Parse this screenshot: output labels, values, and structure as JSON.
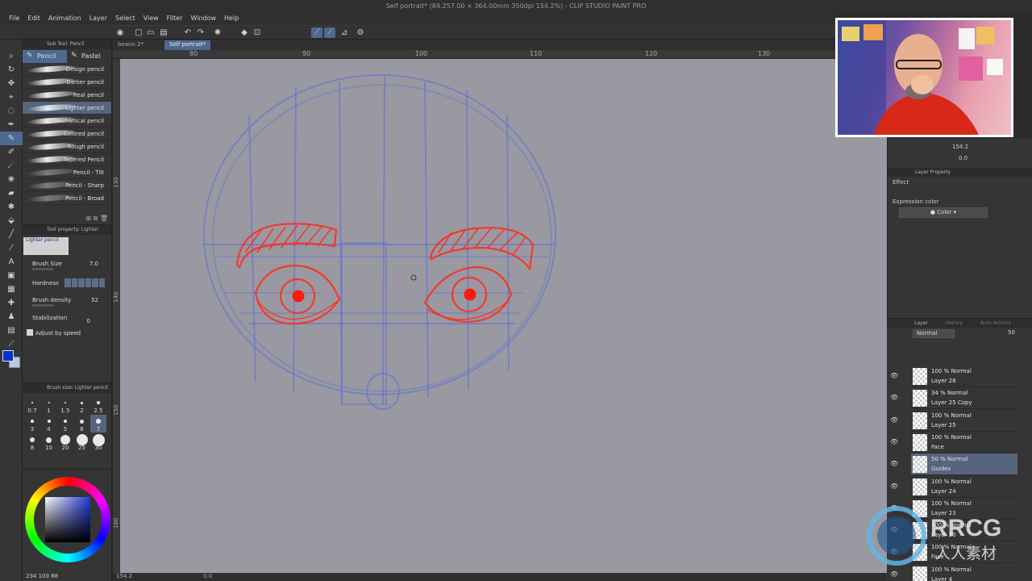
{
  "window": {
    "title": "Self portrait* (84.257.00 × 364.00mm 350dpi 154.2%) - CLIP STUDIO PAINT PRO"
  },
  "menu": [
    "File",
    "Edit",
    "Animation",
    "Layer",
    "Select",
    "View",
    "Filter",
    "Window",
    "Help"
  ],
  "doc_tabs": [
    {
      "label": "beano 2*"
    },
    {
      "label": "Self portrait*"
    }
  ],
  "subtool": {
    "header": "Sub Tool: Pencil",
    "tabs": [
      "Pencil",
      "Pastel"
    ],
    "brushes": [
      "Design pencil",
      "Darker pencil",
      "Real pencil",
      "Lighter pencil",
      "Mechanical pencil",
      "Colored pencil",
      "Rough pencil",
      "Tapered Pencil",
      "Pencil - Tilt",
      "Pencil - Sharp",
      "Pencil - Broad"
    ],
    "selected": "Lighter pencil"
  },
  "tool_property": {
    "header": "Tool property: Lighter penc",
    "preview_label": "Lighter pencil",
    "brush_size_label": "Brush Size",
    "brush_size": "7.0",
    "hardness_label": "Hardness",
    "density_label": "Brush density",
    "density": "52",
    "stabilization_label": "Stabilization",
    "stabilization": "0",
    "adjust_label": "Adjust by speed"
  },
  "brush_size_panel": {
    "header": "Brush size: Lighter pencil",
    "sizes": [
      "0.7",
      "1",
      "1.5",
      "2",
      "2.5",
      "3",
      "4",
      "5",
      "6",
      "7",
      "8",
      "10",
      "20",
      "25",
      "30"
    ],
    "selected": "7"
  },
  "color": {
    "main": "#0033cc",
    "sub": "#b7c8e6",
    "footer": "234 100 88"
  },
  "ruler_x": [
    "80",
    "90",
    "100",
    "110",
    "120",
    "130"
  ],
  "ruler_y": [
    "130",
    "140",
    "150",
    "160"
  ],
  "status": {
    "zoom": "154.2",
    "angle": "0.0"
  },
  "navigator": {
    "zoom": "154.2",
    "angle": "0.0"
  },
  "layer_property": {
    "header": "Layer Property",
    "effect_label": "Effect",
    "expression_label": "Expression color",
    "expression_value": "Color"
  },
  "layer_panel": {
    "tabs": [
      "Layer",
      "History",
      "Auto Actions"
    ],
    "blend_mode": "Normal",
    "opacity": "50",
    "layers": [
      {
        "mode": "100 % Normal",
        "name": "Layer 26"
      },
      {
        "mode": "34 % Normal",
        "name": "Layer 25 Copy"
      },
      {
        "mode": "100 % Normal",
        "name": "Layer 25"
      },
      {
        "mode": "100 % Normal",
        "name": "Face"
      },
      {
        "mode": "50 % Normal",
        "name": "Guides"
      },
      {
        "mode": "100 % Normal",
        "name": "Layer 24"
      },
      {
        "mode": "100 % Normal",
        "name": "Layer 23"
      },
      {
        "mode": "100 % Normal",
        "name": "Layer 20"
      },
      {
        "mode": "100 % Normal",
        "name": "Face"
      },
      {
        "mode": "100 % Normal",
        "name": "Layer 4"
      }
    ],
    "selected": "Guides"
  },
  "watermark": {
    "brand": "RRCG",
    "sub": "人人素材"
  },
  "colors": {
    "accent": "#4f6890",
    "selection": "#55657e",
    "sketch_red": "#ff2a1a",
    "guide_blue": "#5a6fd8",
    "canvas_bg": "#9a99a1"
  }
}
